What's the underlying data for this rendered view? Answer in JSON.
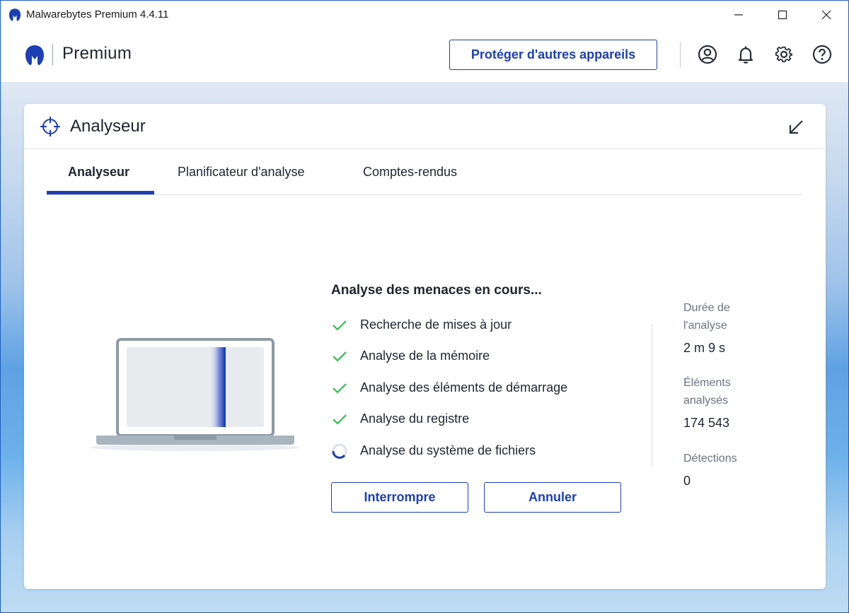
{
  "window": {
    "title": "Malwarebytes Premium  4.4.11"
  },
  "header": {
    "brand": "Premium",
    "protect_button": "Protéger d'autres appareils",
    "icons": [
      "account-icon",
      "bell-icon",
      "gear-icon",
      "help-icon"
    ]
  },
  "card": {
    "title": "Analyseur",
    "tabs": [
      {
        "label": "Analyseur",
        "active": true
      },
      {
        "label": "Planificateur d'analyse",
        "active": false
      },
      {
        "label": "Comptes-rendus",
        "active": false
      }
    ]
  },
  "scan": {
    "heading": "Analyse des menaces en cours...",
    "steps": [
      {
        "label": "Recherche de mises à jour",
        "status": "done"
      },
      {
        "label": "Analyse de la mémoire",
        "status": "done"
      },
      {
        "label": "Analyse des éléments de démarrage",
        "status": "done"
      },
      {
        "label": "Analyse du registre",
        "status": "done"
      },
      {
        "label": "Analyse du système de fichiers",
        "status": "in-progress"
      }
    ],
    "pause_button": "Interrompre",
    "cancel_button": "Annuler"
  },
  "stats": {
    "duration_label_1": "Durée de",
    "duration_label_2": "l'analyse",
    "duration_value": "2 m 9 s",
    "items_label_1": "Éléments",
    "items_label_2": "analysés",
    "items_value": "174 543",
    "detections_label": "Détections",
    "detections_value": "0"
  },
  "colors": {
    "accent": "#1d3fb3",
    "check": "#2fbf4f",
    "text": "#1f2430",
    "muted": "#6b7280"
  }
}
